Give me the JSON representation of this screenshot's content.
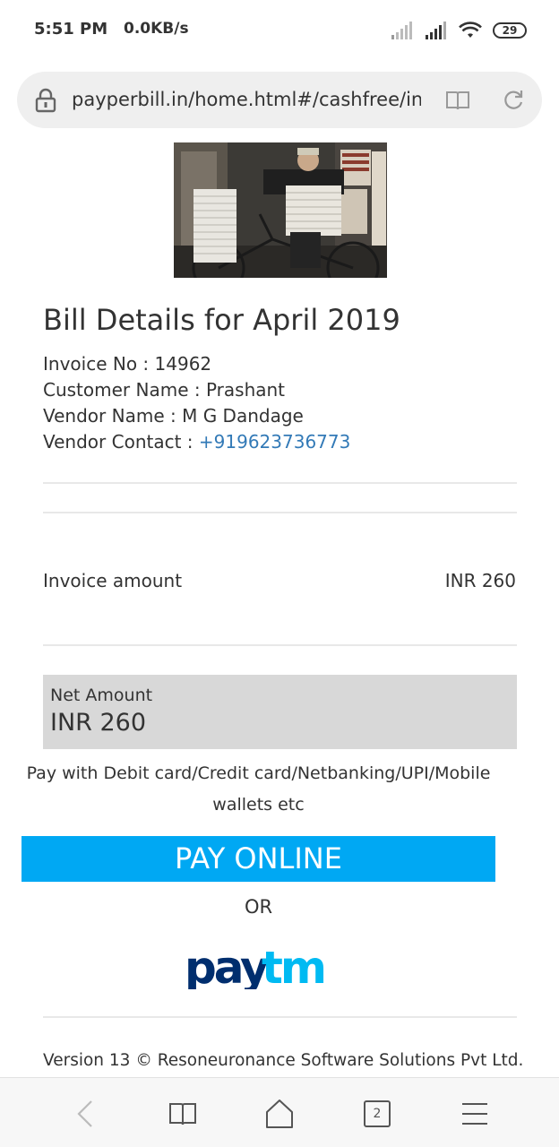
{
  "status": {
    "time": "5:51 PM",
    "speed": "0.0KB/s",
    "battery": "29"
  },
  "browser": {
    "url": "payperbill.in/home.html#/cashfree/inv",
    "tab_count": "2"
  },
  "bill": {
    "title": "Bill Details for April 2019",
    "invoice_label": "Invoice No : ",
    "invoice_no": "14962",
    "customer_label": "Customer Name : ",
    "customer_name": "Prashant",
    "vendor_label": "Vendor Name : ",
    "vendor_name": "M G Dandage",
    "contact_label": "Vendor Contact : ",
    "vendor_contact": "+919623736773"
  },
  "amount": {
    "invoice_label": "Invoice amount",
    "invoice_value": "INR 260",
    "net_label": "Net Amount",
    "net_value": "INR 260"
  },
  "payment": {
    "description": "Pay with Debit card/Credit card/Netbanking/UPI/Mobile wallets etc",
    "pay_button": "PAY ONLINE",
    "or_text": "OR",
    "paytm_logo": "paytm"
  },
  "footer": {
    "text": "Version 13 © Resoneuronance Software Solutions Pvt Ltd."
  },
  "colors": {
    "pay_button": "#00a8f3",
    "link": "#337ab7",
    "paytm_dark": "#002e6e",
    "paytm_light": "#00baf2",
    "net_box": "#d8d8d8"
  }
}
